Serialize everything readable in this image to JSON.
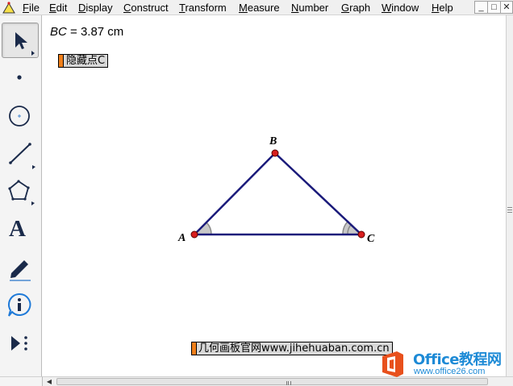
{
  "menubar": {
    "items": [
      {
        "label": "File",
        "underline": "F",
        "rest": "ile"
      },
      {
        "label": "Edit",
        "underline": "E",
        "rest": "dit"
      },
      {
        "label": "Display",
        "underline": "D",
        "rest": "isplay"
      },
      {
        "label": "Construct",
        "underline": "C",
        "rest": "onstruct"
      },
      {
        "label": "Transform",
        "underline": "T",
        "rest": "ransform"
      },
      {
        "label": "Measure",
        "underline": "M",
        "rest": "easure"
      },
      {
        "label": "Number",
        "underline": "N",
        "rest": "umber"
      },
      {
        "label": "Graph",
        "underline": "G",
        "rest": "raph"
      },
      {
        "label": "Window",
        "underline": "W",
        "rest": "indow"
      },
      {
        "label": "Help",
        "underline": "H",
        "rest": "elp"
      }
    ],
    "window_buttons": [
      "_",
      "□",
      "✕"
    ]
  },
  "toolbox": {
    "tools": [
      "arrow-select-icon",
      "point-tool-icon",
      "compass-circle-icon",
      "straightedge-icon",
      "polygon-icon",
      "text-tool-icon",
      "marker-icon",
      "information-icon",
      "custom-tool-icon"
    ],
    "text_tool_glyph": "A"
  },
  "canvas": {
    "measurement": {
      "label": "BC",
      "equals": " = 3.87 cm"
    },
    "hide_button_label": "隐藏点C",
    "url_button_label": "几何画板官网www.jihehuaban.com.cn",
    "points": {
      "A": {
        "label": "A"
      },
      "B": {
        "label": "B"
      },
      "C": {
        "label": "C"
      }
    },
    "colors": {
      "segment": "#1a1a7a",
      "point": "#d81e1e",
      "angle_mark": "#888888",
      "button_accent": "#f07f1a"
    }
  },
  "watermark": {
    "title": "Office教程网",
    "url": "www.office26.com"
  }
}
